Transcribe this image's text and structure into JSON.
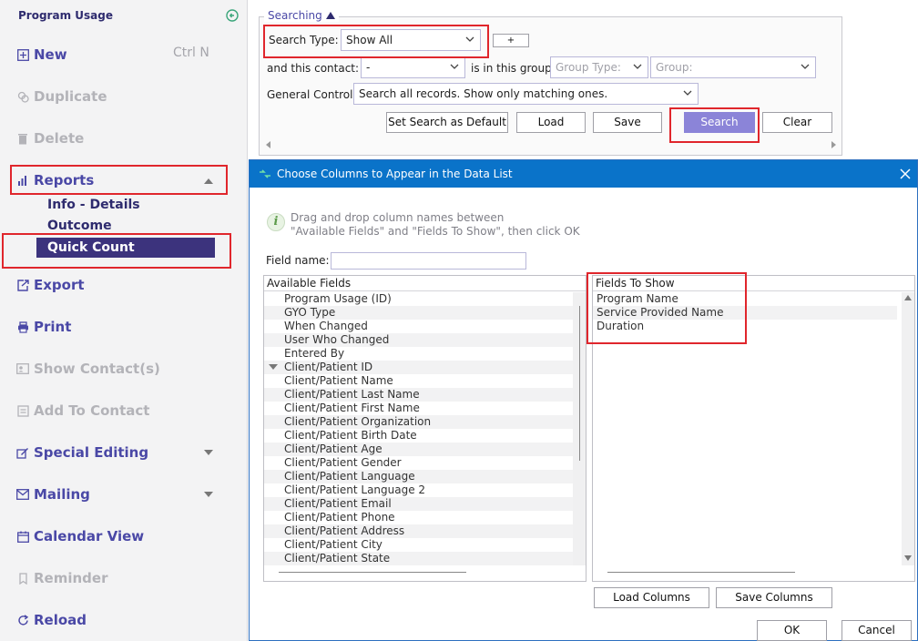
{
  "sidebar": {
    "title": "Program Usage",
    "items": {
      "new": "New",
      "new_shortcut": "Ctrl N",
      "duplicate": "Duplicate",
      "delete": "Delete",
      "reports": "Reports",
      "export": "Export",
      "print": "Print",
      "show_contacts": "Show Contact(s)",
      "add_to_contact": "Add To Contact",
      "special_editing": "Special Editing",
      "mailing": "Mailing",
      "calendar_view": "Calendar View",
      "reminder": "Reminder",
      "reload": "Reload"
    },
    "report_subitems": [
      "Info - Details",
      "Outcome",
      "Quick Count"
    ],
    "selected_subitem": "Quick Count"
  },
  "search": {
    "legend": "Searching",
    "search_type_label": "Search Type:",
    "search_type_value": "Show All",
    "plus_label": "+",
    "contact_label": "and this contact:",
    "contact_value": "-",
    "group_label": "is in this group:",
    "group_type_placeholder": "Group Type:",
    "group_placeholder": "Group:",
    "general_control_label": "General Control:",
    "general_control_value": "Search all records. Show only matching ones.",
    "buttons": {
      "set_default": "Set Search as Default",
      "load": "Load",
      "save": "Save",
      "search": "Search",
      "clear": "Clear"
    }
  },
  "dialog": {
    "title": "Choose Columns to Appear in the Data List",
    "hint_line1": "Drag and drop column names between",
    "hint_line2": "\"Available Fields\" and \"Fields To Show\", then click OK",
    "field_name_label": "Field name:",
    "available_header": "Available Fields",
    "available_fields": [
      "Program Usage (ID)",
      "GYO Type",
      "When Changed",
      "User Who Changed",
      "Entered By",
      "Client/Patient ID",
      "Client/Patient Name",
      "Client/Patient Last Name",
      "Client/Patient First Name",
      "Client/Patient Organization",
      "Client/Patient Birth Date",
      "Client/Patient Age",
      "Client/Patient Gender",
      "Client/Patient Language",
      "Client/Patient Language 2",
      "Client/Patient Email",
      "Client/Patient Phone",
      "Client/Patient Address",
      "Client/Patient City",
      "Client/Patient State"
    ],
    "show_header": "Fields To Show",
    "fields_to_show": [
      "Program Name",
      "Service Provided Name",
      "Duration"
    ],
    "load_columns": "Load Columns",
    "save_columns": "Save Columns",
    "ok": "OK",
    "cancel": "Cancel"
  },
  "colors": {
    "accent": "#4a48a6",
    "selected_bg": "#3c337d",
    "title_bar": "#0a73c9",
    "highlight_box": "#e0262c",
    "search_button": "#8b84d8"
  }
}
